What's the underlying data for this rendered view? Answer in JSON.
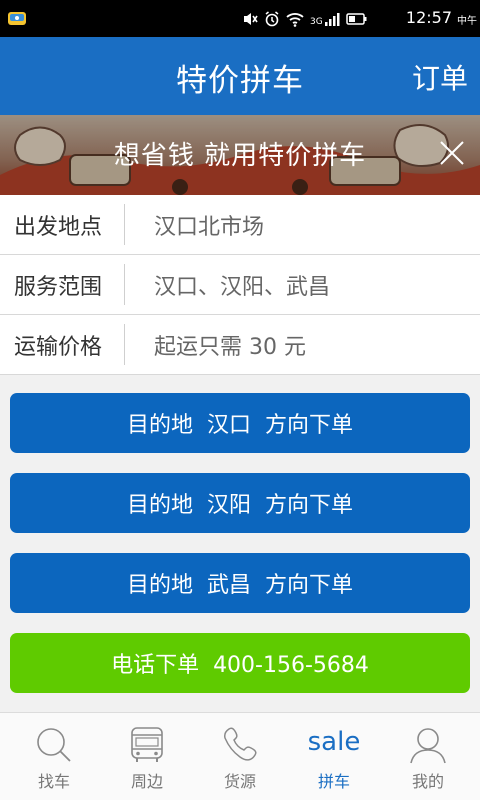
{
  "status_bar": {
    "time": "12:57",
    "ampm": "中午",
    "network": "3G"
  },
  "header": {
    "title": "特价拼车",
    "orders_label": "订单"
  },
  "banner": {
    "text": "想省钱 就用特价拼车"
  },
  "info": [
    {
      "label": "出发地点",
      "value": "汉口北市场"
    },
    {
      "label": "服务范围",
      "value": "汉口、汉阳、武昌"
    },
    {
      "label": "运输价格",
      "value": "起运只需 30 元"
    }
  ],
  "buttons": [
    {
      "label": "目的地  汉口  方向下单"
    },
    {
      "label": "目的地  汉阳  方向下单"
    },
    {
      "label": "目的地  武昌  方向下单"
    }
  ],
  "phone_button": {
    "label": "电话下单  400-156-5684"
  },
  "colors": {
    "brand": "#1a6ec3",
    "button_blue": "#0c66be",
    "button_green": "#5fcb00"
  },
  "nav": [
    {
      "label": "找车",
      "icon": "search-icon"
    },
    {
      "label": "周边",
      "icon": "bus-icon"
    },
    {
      "label": "货源",
      "icon": "phone-icon"
    },
    {
      "label": "拼车",
      "icon": "sale-icon",
      "icon_text": "sale",
      "active": true
    },
    {
      "label": "我的",
      "icon": "user-icon"
    }
  ]
}
